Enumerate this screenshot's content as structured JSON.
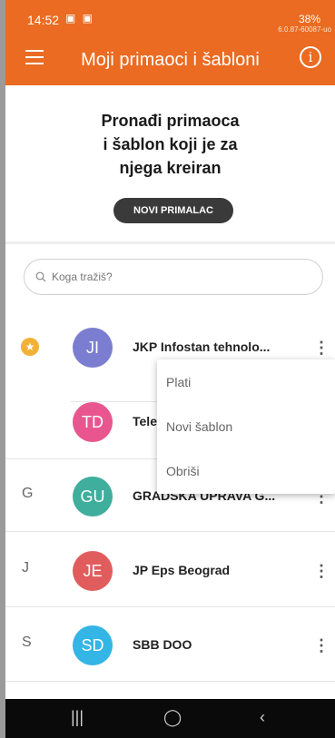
{
  "status_bar": {
    "time": "14:52",
    "right": "38%",
    "version": "6.0.87-60087-uo"
  },
  "app_bar": {
    "title": "Moji primaoci i šabloni"
  },
  "hero": {
    "line1": "Pronađi primaoca",
    "line2": "i šablon koji je za",
    "line3": "njega kreiran",
    "button": "NOVI PRIMALAC"
  },
  "search": {
    "placeholder": "Koga tražiš?"
  },
  "list": [
    {
      "section": "",
      "initials": "JI",
      "name": "JKP Infostan tehnolo...",
      "color": "#7b7ed0",
      "starred": true
    },
    {
      "section": "",
      "initials": "TD",
      "name": "Tele",
      "color": "#e9568f",
      "starred": false
    },
    {
      "section": "G",
      "initials": "GU",
      "name": "GRADSKA UPRAVA G...",
      "color": "#3fae9c",
      "starred": false
    },
    {
      "section": "J",
      "initials": "JE",
      "name": "JP Eps Beograd",
      "color": "#e15d5d",
      "starred": false
    },
    {
      "section": "S",
      "initials": "SD",
      "name": "SBB DOO",
      "color": "#33b5e5",
      "starred": false
    }
  ],
  "menu": {
    "items": [
      "Plati",
      "Novi šablon",
      "Obriši"
    ]
  },
  "colors": {
    "brand": "#ea6b21",
    "star": "#f2b136"
  }
}
